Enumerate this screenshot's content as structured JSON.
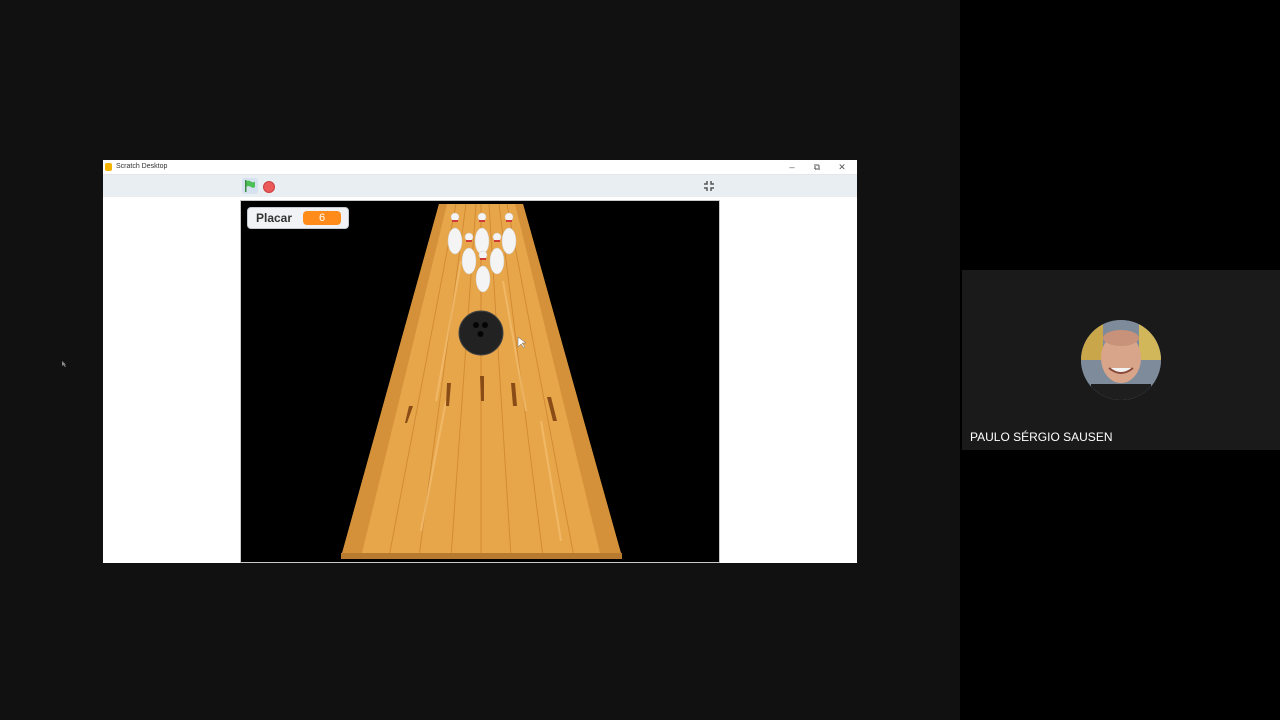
{
  "window": {
    "title": "Scratch Desktop",
    "minimize_glyph": "–",
    "restore_glyph": "⧉",
    "close_glyph": "✕"
  },
  "toolbar": {
    "green_flag_icon": "green-flag-icon",
    "stop_icon": "stop-icon",
    "fullscreen_icon": "fullscreen-exit-icon"
  },
  "stage": {
    "monitor_label": "Placar",
    "monitor_value": "6"
  },
  "meeting": {
    "participant_name": "PAULO SÉRGIO SAUSEN"
  },
  "colors": {
    "lane": "#e9a94c",
    "monitor_value_bg": "#ff8c1a",
    "stop_button": "#ec5959",
    "flag": "#4cbf56"
  }
}
